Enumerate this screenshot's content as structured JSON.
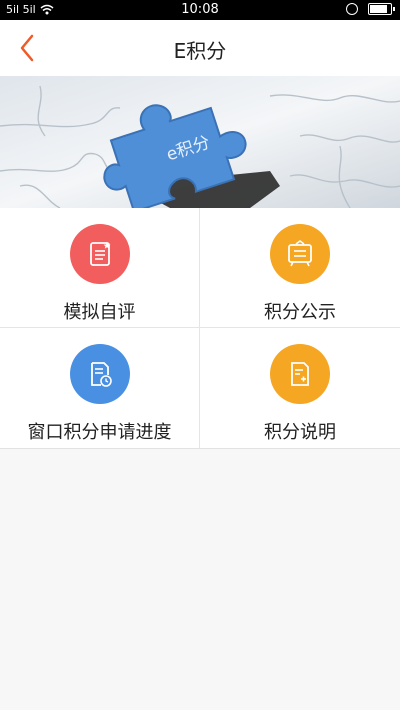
{
  "status": {
    "signal_left": "5il 5il",
    "time": "10:08"
  },
  "nav": {
    "title": "E积分"
  },
  "banner": {
    "puzzle_text": "e积分"
  },
  "menu": [
    {
      "label": "模拟自评",
      "icon": "document-star-icon",
      "color": "#f25e5e"
    },
    {
      "label": "积分公示",
      "icon": "notice-board-icon",
      "color": "#f5a623"
    },
    {
      "label": "窗口积分申请进度",
      "icon": "document-clock-icon",
      "color": "#4a90e2"
    },
    {
      "label": "积分说明",
      "icon": "document-plus-icon",
      "color": "#f5a623"
    }
  ]
}
